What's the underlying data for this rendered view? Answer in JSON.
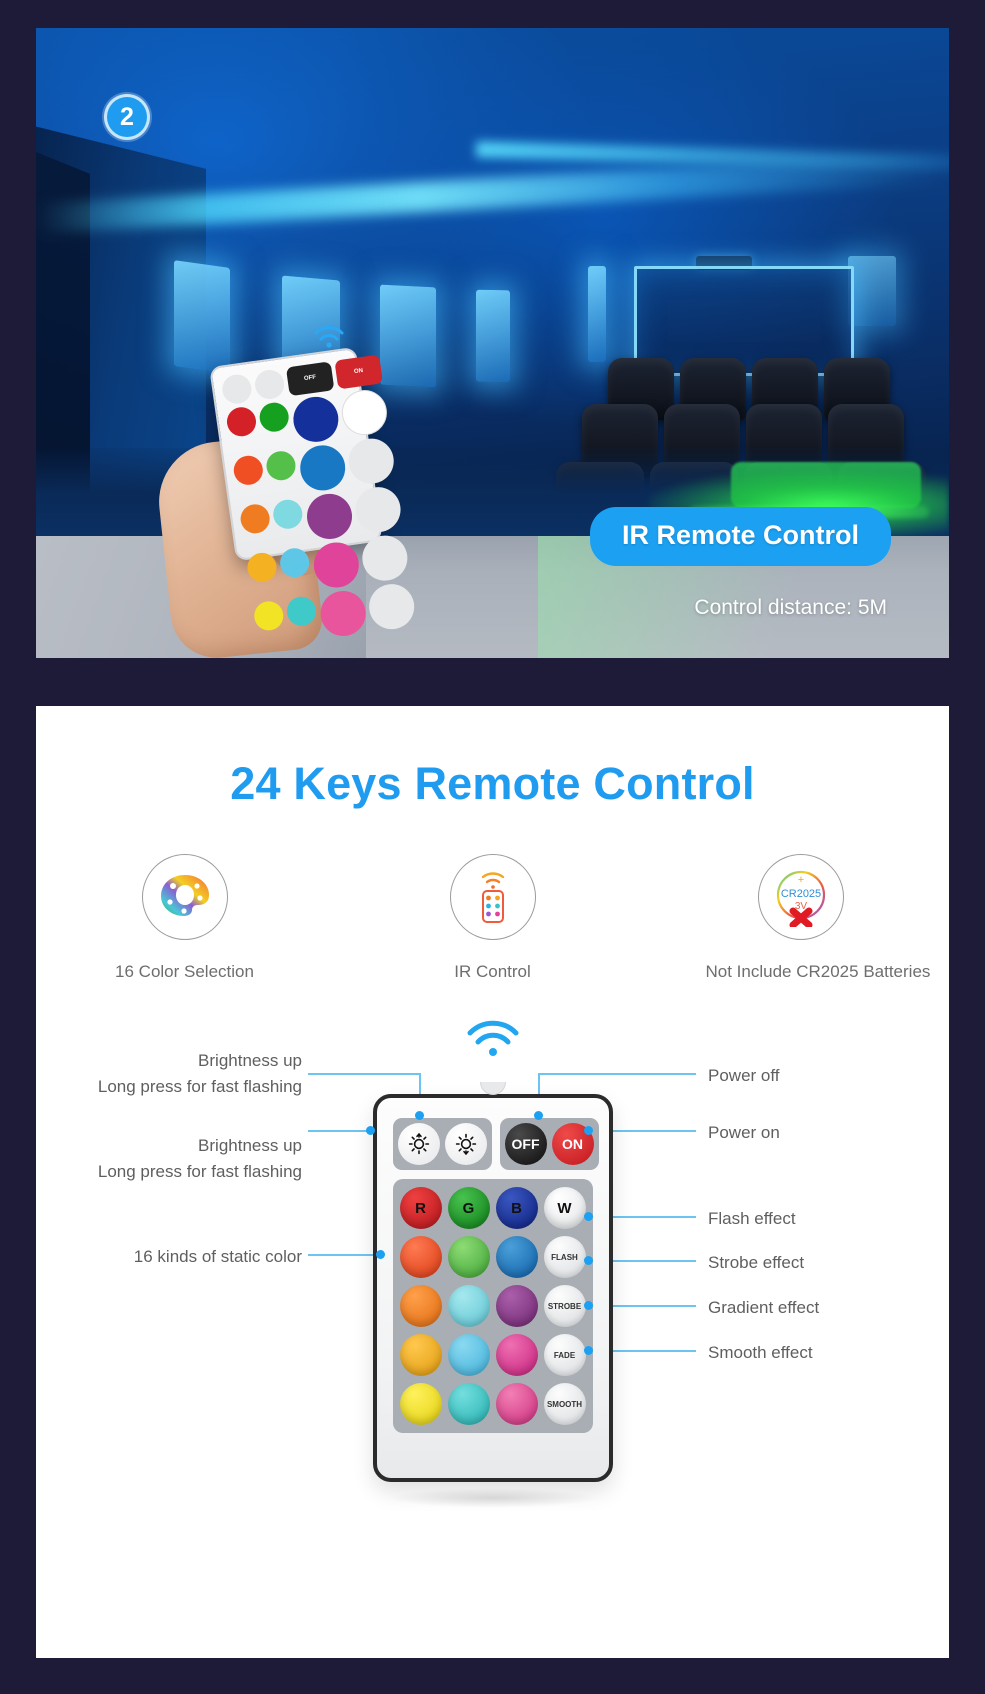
{
  "top_card": {
    "badge": "2",
    "pill_label": "IR Remote Control",
    "sub_label": "Control distance: 5M"
  },
  "info_card": {
    "title": "24 Keys Remote Control",
    "features": [
      {
        "icon": "color-palette-icon",
        "caption": "16 Color Selection"
      },
      {
        "icon": "ir-remote-icon",
        "caption": "IR Control"
      },
      {
        "icon": "cr2025-battery-icon",
        "caption": "Not Include CR2025 Batteries"
      }
    ],
    "remote": {
      "top_keys": [
        {
          "name": "brightness-up-key",
          "label": ""
        },
        {
          "name": "brightness-down-key",
          "label": ""
        },
        {
          "name": "power-off-key",
          "label": "OFF"
        },
        {
          "name": "power-on-key",
          "label": "ON"
        }
      ],
      "rgbw_row": [
        {
          "label": "R",
          "color": "#d42027"
        },
        {
          "label": "G",
          "color": "#16a01f"
        },
        {
          "label": "B",
          "color": "#14309a"
        },
        {
          "label": "W",
          "color": "#fdfdfd"
        }
      ],
      "color_rows": [
        [
          "#f04e23",
          "#54c04a",
          "#1878c4"
        ],
        [
          "#f07c22",
          "#7fd9e0",
          "#8e3c8e"
        ],
        [
          "#f4b223",
          "#5ec7e8",
          "#e0439a"
        ],
        [
          "#f2e325",
          "#3fc9c9",
          "#e8559c"
        ]
      ],
      "effect_keys": [
        "FLASH",
        "STROBE",
        "FADE",
        "SMOOTH"
      ]
    },
    "callouts_left": [
      {
        "line1": "Brightness up",
        "line2": "Long press for fast flashing"
      },
      {
        "line1": "Brightness up",
        "line2": "Long press for fast flashing"
      },
      {
        "line1": "16 kinds of static color",
        "line2": ""
      }
    ],
    "callouts_right": [
      "Power off",
      "Power on",
      "Flash effect",
      "Strobe effect",
      "Gradient effect",
      "Smooth effect"
    ]
  },
  "colors": {
    "background": "#1e1b38",
    "accent_blue": "#1ba0f2",
    "line_blue": "#6cc5f0",
    "text_gray": "#5f5f5f"
  }
}
